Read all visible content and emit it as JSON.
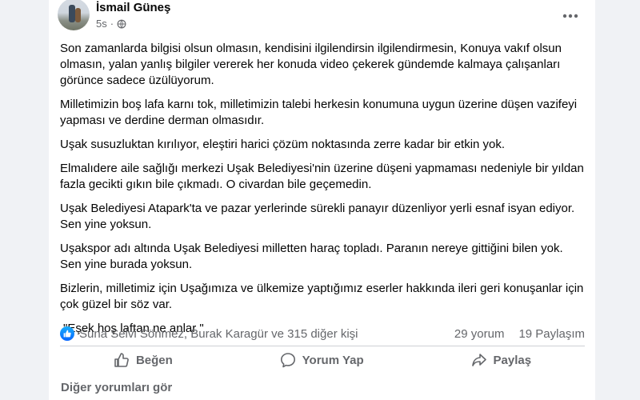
{
  "post": {
    "author": "İsmail Güneş",
    "time": "5s",
    "paragraphs": [
      "Son zamanlarda bilgisi olsun olmasın, kendisini ilgilendirsin ilgilendirmesin, Konuya vakıf olsun olmasın, yalan yanlış bilgiler vererek her konuda video çekerek gündemde kalmaya çalışanları görünce sadece üzülüyorum.",
      "Milletimizin boş lafa karnı tok, milletimizin talebi herkesin konumuna uygun üzerine düşen vazifeyi yapması ve derdine derman olmasıdır.",
      "Uşak susuzluktan kırılıyor, eleştiri harici çözüm noktasında zerre kadar bir etkin yok.",
      "Elmalıdere aile sağlığı merkezi Uşak Belediyesi'nin üzerine düşeni yapmaması nedeniyle bir yıldan fazla gecikti gıkın bile çıkmadı. O civardan bile geçemedin.",
      "Uşak Belediyesi Atapark'ta ve pazar yerlerinde sürekli panayır düzenliyor yerli esnaf isyan ediyor. Sen yine yoksun.",
      "Uşakspor adı altında Uşak Belediyesi milletten haraç topladı. Paranın nereye gittiğini bilen yok. Sen yine burada yoksun.",
      "Bizlerin, milletimiz için Uşağımıza ve ülkemize yaptığımız eserler hakkında ileri geri konuşanlar için çok güzel bir söz var."
    ],
    "quote": "\"Eşek hoş laftan ne anlar \""
  },
  "stats": {
    "reactions_text": "Suna Selvi Sönmez, Burak Karagür ve 315 diğer kişi",
    "comments": "29 yorum",
    "shares": "19 Paylaşım"
  },
  "actions": {
    "like": "Beğen",
    "comment": "Yorum Yap",
    "share": "Paylaş"
  },
  "more_comments": "Diğer yorumları gör",
  "colors": {
    "like_blue": "#0866ff",
    "secondary_text": "#65676b",
    "divider": "#ced0d4"
  },
  "icons": {
    "like_reaction": "like-reaction-icon",
    "privacy": "globe-icon",
    "more": "more-horizontal-icon",
    "like_action": "thumbs-up-icon",
    "comment_action": "comment-bubble-icon",
    "share_action": "share-arrow-icon"
  }
}
